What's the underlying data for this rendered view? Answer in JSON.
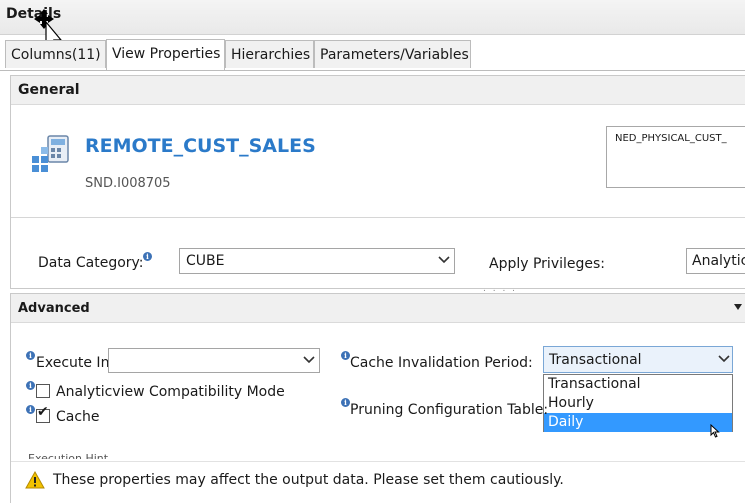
{
  "window": {
    "title": "Details"
  },
  "tabs": [
    {
      "label": "Columns(11)",
      "active": false
    },
    {
      "label": "View Properties",
      "active": true
    },
    {
      "label": "Hierarchies",
      "active": false
    },
    {
      "label": "Parameters/Variables",
      "active": false
    }
  ],
  "general": {
    "header": "General",
    "view_name": "REMOTE_CUST_SALES",
    "package": "SND.I008705",
    "description": "NED_PHYSICAL_CUST_",
    "data_category": {
      "label": "Data Category:",
      "value": "CUBE"
    },
    "apply_privileges": {
      "label": "Apply Privileges:",
      "value": "Analytic"
    },
    "sash": ". . . ."
  },
  "advanced": {
    "header": "Advanced",
    "execute_in": {
      "label": "Execute In:",
      "value": ""
    },
    "analyticview_compat": {
      "label": "Analyticview Compatibility Mode",
      "checked": false
    },
    "cache": {
      "label": "Cache",
      "checked": true,
      "mark": "✔"
    },
    "cache_invalidation": {
      "label": "Cache Invalidation Period:",
      "value": "Transactional",
      "options": [
        "Transactional",
        "Hourly",
        "Daily"
      ],
      "highlighted": "Daily"
    },
    "pruning": {
      "label": "Pruning Configuration Table:"
    },
    "hidden_row": "Execution Hint"
  },
  "warning": {
    "text": "These properties may affect the output data. Please set them cautiously."
  },
  "icons": {
    "info": "info-icon",
    "warning": "warning-icon",
    "dropdown": "chevron-down-icon",
    "view": "calculation-view-icon"
  },
  "colors": {
    "link_blue": "#2b7ac9",
    "selection_blue": "#3399ff",
    "info_blue": "#3d72b6",
    "warning_yellow": "#f2c200"
  }
}
